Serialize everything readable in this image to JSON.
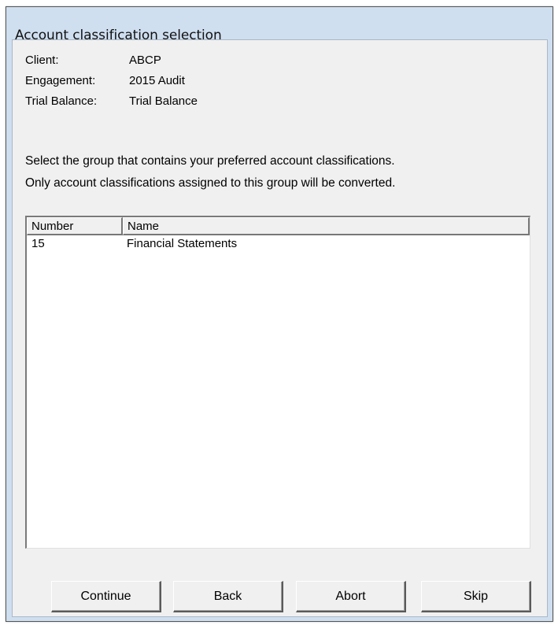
{
  "window": {
    "title": "Account classification selection"
  },
  "info": [
    {
      "label": "Client:",
      "value": "ABCP"
    },
    {
      "label": "Engagement:",
      "value": "2015 Audit"
    },
    {
      "label": "Trial Balance:",
      "value": "Trial Balance"
    }
  ],
  "instructions": [
    "Select the group that contains your preferred account classifications.",
    "Only account classifications assigned to this group will be converted."
  ],
  "list": {
    "columns": [
      "Number",
      "Name"
    ],
    "rows": [
      {
        "number": "15",
        "name": "Financial Statements"
      }
    ]
  },
  "buttons": {
    "continue": "Continue",
    "back": "Back",
    "abort": "Abort",
    "skip": "Skip"
  }
}
